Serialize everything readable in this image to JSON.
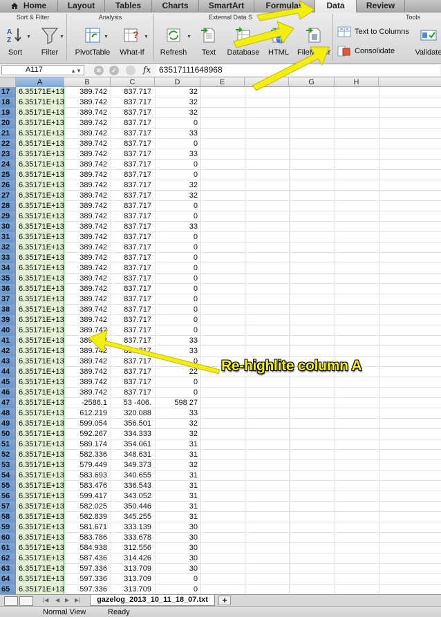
{
  "tabs": [
    "Home",
    "Layout",
    "Tables",
    "Charts",
    "SmartArt",
    "Formulas",
    "Data",
    "Review"
  ],
  "ribbon": {
    "groups": {
      "sort_filter": "Sort & Filter",
      "analysis": "Analysis",
      "external": "External Data S",
      "tools": "Tools"
    },
    "buttons": {
      "sort": "Sort",
      "filter": "Filter",
      "pivot": "PivotTable",
      "whatif": "What-If",
      "refresh": "Refresh",
      "text": "Text",
      "database": "Database",
      "html": "HTML",
      "filemaker": "FileMaker",
      "validate": "Validate"
    },
    "text_to_columns": "Text to Columns",
    "consolidate": "Consolidate"
  },
  "formula_bar": {
    "name_box": "A117",
    "fx": "fx",
    "content": "63517111648968"
  },
  "columns": [
    "A",
    "B",
    "C",
    "D",
    "E",
    "F",
    "G",
    "H"
  ],
  "rows": [
    {
      "n": "17",
      "a": "6.35171E+13",
      "b": "389.742",
      "c": "837.717",
      "d": "32"
    },
    {
      "n": "18",
      "a": "6.35171E+13",
      "b": "389.742",
      "c": "837.717",
      "d": "32"
    },
    {
      "n": "19",
      "a": "6.35171E+13",
      "b": "389.742",
      "c": "837.717",
      "d": "32"
    },
    {
      "n": "20",
      "a": "6.35171E+13",
      "b": "389.742",
      "c": "837.717",
      "d": "0"
    },
    {
      "n": "21",
      "a": "6.35171E+13",
      "b": "389.742",
      "c": "837.717",
      "d": "33"
    },
    {
      "n": "22",
      "a": "6.35171E+13",
      "b": "389.742",
      "c": "837.717",
      "d": "0"
    },
    {
      "n": "23",
      "a": "6.35171E+13",
      "b": "389.742",
      "c": "837.717",
      "d": "33"
    },
    {
      "n": "24",
      "a": "6.35171E+13",
      "b": "389.742",
      "c": "837.717",
      "d": "0"
    },
    {
      "n": "25",
      "a": "6.35171E+13",
      "b": "389.742",
      "c": "837.717",
      "d": "0"
    },
    {
      "n": "26",
      "a": "6.35171E+13",
      "b": "389.742",
      "c": "837.717",
      "d": "32"
    },
    {
      "n": "27",
      "a": "6.35171E+13",
      "b": "389.742",
      "c": "837.717",
      "d": "32"
    },
    {
      "n": "28",
      "a": "6.35171E+13",
      "b": "389.742",
      "c": "837.717",
      "d": "0"
    },
    {
      "n": "29",
      "a": "6.35171E+13",
      "b": "389.742",
      "c": "837.717",
      "d": "0"
    },
    {
      "n": "30",
      "a": "6.35171E+13",
      "b": "389.742",
      "c": "837.717",
      "d": "33"
    },
    {
      "n": "31",
      "a": "6.35171E+13",
      "b": "389.742",
      "c": "837.717",
      "d": "0"
    },
    {
      "n": "32",
      "a": "6.35171E+13",
      "b": "389.742",
      "c": "837.717",
      "d": "0"
    },
    {
      "n": "33",
      "a": "6.35171E+13",
      "b": "389.742",
      "c": "837.717",
      "d": "0"
    },
    {
      "n": "34",
      "a": "6.35171E+13",
      "b": "389.742",
      "c": "837.717",
      "d": "0"
    },
    {
      "n": "35",
      "a": "6.35171E+13",
      "b": "389.742",
      "c": "837.717",
      "d": "0"
    },
    {
      "n": "36",
      "a": "6.35171E+13",
      "b": "389.742",
      "c": "837.717",
      "d": "0"
    },
    {
      "n": "37",
      "a": "6.35171E+13",
      "b": "389.742",
      "c": "837.717",
      "d": "0"
    },
    {
      "n": "38",
      "a": "6.35171E+13",
      "b": "389.742",
      "c": "837.717",
      "d": "0"
    },
    {
      "n": "39",
      "a": "6.35171E+13",
      "b": "389.742",
      "c": "837.717",
      "d": "0"
    },
    {
      "n": "40",
      "a": "6.35171E+13",
      "b": "389.742",
      "c": "837.717",
      "d": "0"
    },
    {
      "n": "41",
      "a": "6.35171E+13",
      "b": "389.742",
      "c": "837.717",
      "d": "33"
    },
    {
      "n": "42",
      "a": "6.35171E+13",
      "b": "389.742",
      "c": "837.717",
      "d": "33"
    },
    {
      "n": "43",
      "a": "6.35171E+13",
      "b": "389.742",
      "c": "837.717",
      "d": "0"
    },
    {
      "n": "44",
      "a": "6.35171E+13",
      "b": "389.742",
      "c": "837.717",
      "d": "22"
    },
    {
      "n": "45",
      "a": "6.35171E+13",
      "b": "389.742",
      "c": "837.717",
      "d": "0"
    },
    {
      "n": "46",
      "a": "6.35171E+13",
      "b": "389.742",
      "c": "837.717",
      "d": "0"
    },
    {
      "n": "47",
      "a": "6.35171E+13",
      "b": "-2586.1",
      "c": "53 -406.",
      "d": "598 27"
    },
    {
      "n": "48",
      "a": "6.35171E+13",
      "b": "612.219",
      "c": "320.088",
      "d": "33"
    },
    {
      "n": "49",
      "a": "6.35171E+13",
      "b": "599.054",
      "c": "356.501",
      "d": "32"
    },
    {
      "n": "50",
      "a": "6.35171E+13",
      "b": "592.267",
      "c": "334.333",
      "d": "32"
    },
    {
      "n": "51",
      "a": "6.35171E+13",
      "b": "589.174",
      "c": "354.061",
      "d": "31"
    },
    {
      "n": "52",
      "a": "6.35171E+13",
      "b": "582.336",
      "c": "348.631",
      "d": "31"
    },
    {
      "n": "53",
      "a": "6.35171E+13",
      "b": "579.449",
      "c": "349.373",
      "d": "32"
    },
    {
      "n": "54",
      "a": "6.35171E+13",
      "b": "583.693",
      "c": "340.655",
      "d": "31"
    },
    {
      "n": "55",
      "a": "6.35171E+13",
      "b": "583.476",
      "c": "336.543",
      "d": "31"
    },
    {
      "n": "56",
      "a": "6.35171E+13",
      "b": "599.417",
      "c": "343.052",
      "d": "31"
    },
    {
      "n": "57",
      "a": "6.35171E+13",
      "b": "582.025",
      "c": "350.446",
      "d": "31"
    },
    {
      "n": "58",
      "a": "6.35171E+13",
      "b": "582.839",
      "c": "345.255",
      "d": "31"
    },
    {
      "n": "59",
      "a": "6.35171E+13",
      "b": "581.671",
      "c": "333.139",
      "d": "30"
    },
    {
      "n": "60",
      "a": "6.35171E+13",
      "b": "583.786",
      "c": "333.678",
      "d": "30"
    },
    {
      "n": "61",
      "a": "6.35171E+13",
      "b": "584.938",
      "c": "312.556",
      "d": "30"
    },
    {
      "n": "62",
      "a": "6.35171E+13",
      "b": "587.436",
      "c": "314.426",
      "d": "30"
    },
    {
      "n": "63",
      "a": "6.35171E+13",
      "b": "597.336",
      "c": "313.709",
      "d": "30"
    },
    {
      "n": "64",
      "a": "6.35171E+13",
      "b": "597.336",
      "c": "313.709",
      "d": "0"
    },
    {
      "n": "65",
      "a": "6.35171E+13",
      "b": "597.336",
      "c": "313.709",
      "d": "0"
    }
  ],
  "sheet_tab": "gazelog_2013_10_11_18_07.txt",
  "status": {
    "view": "Normal View",
    "state": "Ready"
  },
  "annotation": "Re-highlite column A",
  "colors": {
    "arrow": "#f2ee12",
    "selection": "#e3f0d6",
    "header_sel": "#7ea7d6"
  }
}
